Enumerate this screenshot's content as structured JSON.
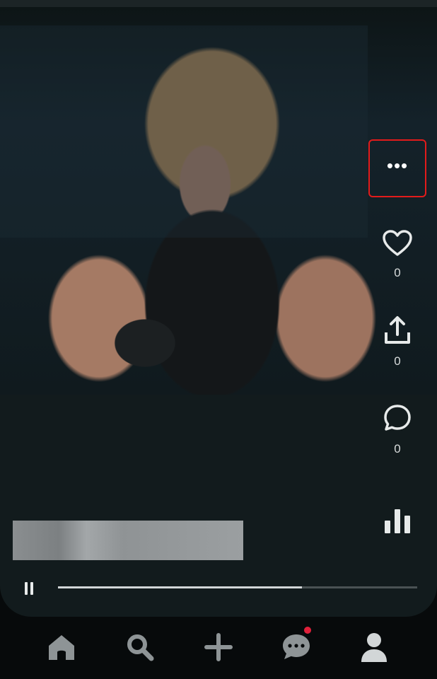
{
  "post": {
    "likes": "0",
    "shares": "0",
    "comments": "0",
    "progress": 0.68
  },
  "icons": {
    "more": "more-horizontal-icon",
    "like": "heart-icon",
    "share": "share-upload-icon",
    "comment": "comment-bubble-icon",
    "stats": "bar-chart-icon",
    "pause": "pause-icon"
  },
  "tabs": [
    {
      "name": "home",
      "icon": "home-icon"
    },
    {
      "name": "search",
      "icon": "search-icon"
    },
    {
      "name": "create",
      "icon": "plus-icon"
    },
    {
      "name": "messages",
      "icon": "chat-bubble-icon",
      "has_notification": true
    },
    {
      "name": "profile",
      "icon": "person-icon"
    }
  ],
  "colors": {
    "highlight_box": "#e31b1b",
    "notification_dot": "#e0203a",
    "card_bg": "#121b1d"
  }
}
